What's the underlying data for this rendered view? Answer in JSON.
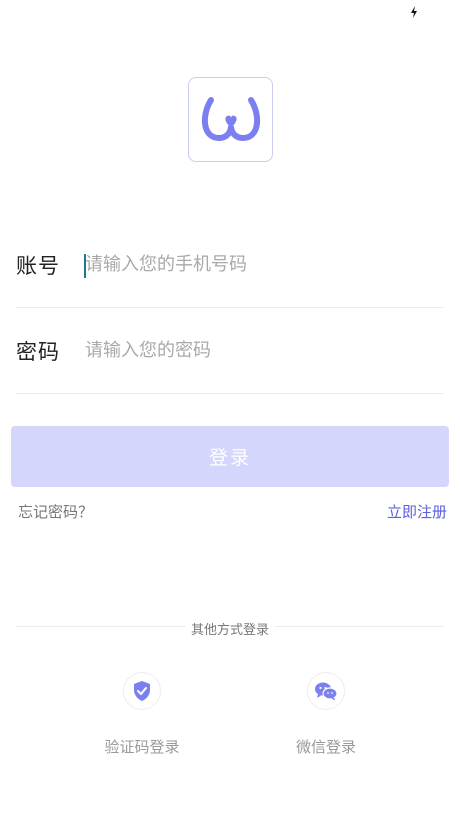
{
  "form": {
    "account_label": "账号",
    "account_placeholder": "请输入您的手机号码",
    "password_label": "密码",
    "password_placeholder": "请输入您的密码"
  },
  "actions": {
    "login_label": "登录",
    "forgot_label": "忘记密码？",
    "register_label": "立即注册"
  },
  "other_login": {
    "divider_label": "其他方式登录",
    "sms_label": "验证码登录",
    "wechat_label": "微信登录"
  },
  "icons": {
    "status": "lightning-bolt-icon",
    "logo": "app-logo-icon",
    "sms": "shield-check-icon",
    "wechat": "wechat-icon"
  },
  "colors": {
    "accent": "#5960e0",
    "button_disabled": "#d4d7fb",
    "logo": "#7b7ff0"
  }
}
